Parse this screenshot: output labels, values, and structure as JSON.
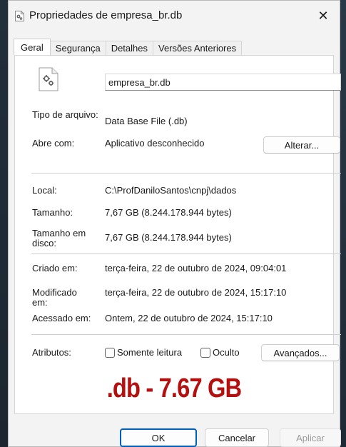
{
  "window": {
    "title": "Propriedades de empresa_br.db",
    "close_glyph": "✕"
  },
  "tabs": [
    {
      "label": "Geral",
      "active": true
    },
    {
      "label": "Segurança",
      "active": false
    },
    {
      "label": "Detalhes",
      "active": false
    },
    {
      "label": "Versões Anteriores",
      "active": false
    }
  ],
  "general": {
    "file_name": "empresa_br.db",
    "file_icon": "settings-file-icon",
    "type_label": "Tipo de arquivo:",
    "type_value": "Data Base File (.db)",
    "opens_with_label": "Abre com:",
    "opens_with_value": "Aplicativo desconhecido",
    "change_button": "Alterar...",
    "location_label": "Local:",
    "location_value": "C:\\ProfDaniloSantos\\cnpj\\dados",
    "size_label": "Tamanho:",
    "size_value": "7,67 GB (8.244.178.944 bytes)",
    "size_on_disk_label": "Tamanho em disco:",
    "size_on_disk_value": "7,67 GB (8.244.178.944 bytes)",
    "created_label": "Criado em:",
    "created_value": "terça-feira, 22 de outubro de 2024, 09:04:01",
    "modified_label": "Modificado em:",
    "modified_value": "terça-feira, 22 de outubro de 2024, 15:17:10",
    "accessed_label": "Acessado em:",
    "accessed_value": "Ontem, 22 de outubro de 2024, 15:17:10",
    "attributes_label": "Atributos:",
    "readonly_label": "Somente leitura",
    "readonly_checked": false,
    "hidden_label": "Oculto",
    "hidden_checked": false,
    "advanced_button": "Avançados..."
  },
  "overlay_text": ".db  -  7.67 GB",
  "footer": {
    "ok": "OK",
    "cancel": "Cancelar",
    "apply": "Aplicar"
  },
  "colors": {
    "accent": "#005fb8",
    "overlay": "#b3100f"
  }
}
